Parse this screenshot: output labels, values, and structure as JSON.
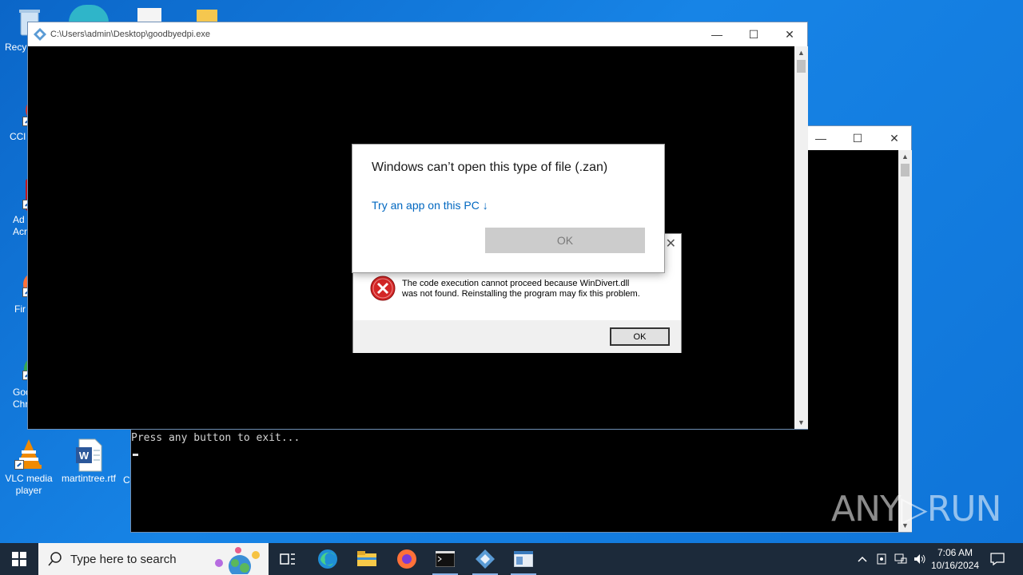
{
  "desktop": {
    "icons": [
      {
        "label": "Recy",
        "icon": "recycle-bin-icon"
      },
      {
        "label": "CCl",
        "icon": "ccleaner-icon"
      },
      {
        "label": "Ad Acr",
        "icon": "acrobat-icon"
      },
      {
        "label": "Fir",
        "icon": "firefox-icon"
      },
      {
        "label": "Goo Chr",
        "icon": "chrome-icon"
      },
      {
        "label": "VLC media player",
        "icon": "vlc-icon"
      },
      {
        "label": "martintree.rtf",
        "icon": "word-document-icon"
      },
      {
        "label": "C",
        "icon": "generic-icon"
      }
    ]
  },
  "main_window": {
    "title": "C:\\Users\\admin\\Desktop\\goodbyedpi.exe",
    "minimize": "—",
    "maximize": "☐",
    "close": "✕"
  },
  "back_window": {
    "minimize": "—",
    "maximize": "☐",
    "close": "✕",
    "console_text": "Press any button to exit..."
  },
  "dialog_open_with": {
    "heading": "Windows can’t open this type of file (.zan)",
    "link": "Try an app on this PC ↓",
    "ok_label": "OK"
  },
  "dialog_error": {
    "close": "✕",
    "message_line1": "The code execution cannot proceed because WinDivert.dll",
    "message_line2": "was not found. Reinstalling the program may fix this problem.",
    "ok_label": "OK"
  },
  "taskbar": {
    "search_placeholder": "Type here to search",
    "time": "7:06 AM",
    "date": "10/16/2024"
  },
  "watermark": "ANY▷RUN"
}
